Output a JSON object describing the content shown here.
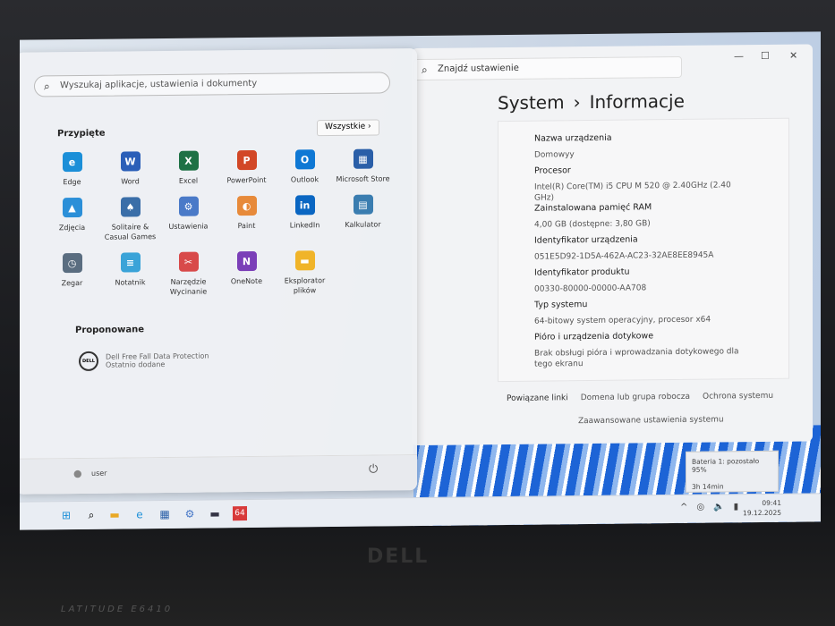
{
  "start": {
    "search_placeholder": "Wyszukaj aplikacje, ustawienia i dokumenty",
    "pinned": "Przypięte",
    "all": "Wszystkie ›",
    "apps": [
      {
        "label": "Edge",
        "icon": "edge-icon",
        "color": "#1b8fd8",
        "g": "e"
      },
      {
        "label": "Word",
        "icon": "word-icon",
        "color": "#2b5fb8",
        "g": "W"
      },
      {
        "label": "Excel",
        "icon": "excel-icon",
        "color": "#1e7145",
        "g": "X"
      },
      {
        "label": "PowerPoint",
        "icon": "powerpoint-icon",
        "color": "#d24726",
        "g": "P"
      },
      {
        "label": "Outlook",
        "icon": "outlook-icon",
        "color": "#0f78d4",
        "g": "O"
      },
      {
        "label": "Microsoft Store",
        "icon": "store-icon",
        "color": "#2a5fa8",
        "g": "▦"
      },
      {
        "label": "Zdjęcia",
        "icon": "photos-icon",
        "color": "#2b8fd8",
        "g": "▲"
      },
      {
        "label": "Solitaire & Casual Games",
        "icon": "solitaire-icon",
        "color": "#3a6ea8",
        "g": "♠"
      },
      {
        "label": "Ustawienia",
        "icon": "settings-icon",
        "color": "#4a7ac8",
        "g": "⚙"
      },
      {
        "label": "Paint",
        "icon": "paint-icon",
        "color": "#e78a3a",
        "g": "◐"
      },
      {
        "label": "LinkedIn",
        "icon": "linkedin-icon",
        "color": "#0a66c2",
        "g": "in"
      },
      {
        "label": "Kalkulator",
        "icon": "calculator-icon",
        "color": "#3a7db0",
        "g": "▤"
      },
      {
        "label": "Zegar",
        "icon": "clock-icon",
        "color": "#5a6d80",
        "g": "◷"
      },
      {
        "label": "Notatnik",
        "icon": "notepad-icon",
        "color": "#3aa3d8",
        "g": "≡"
      },
      {
        "label": "Narzędzie Wycinanie",
        "icon": "snipping-tool-icon",
        "color": "#d84a4a",
        "g": "✂"
      },
      {
        "label": "OneNote",
        "icon": "onenote-icon",
        "color": "#7b3fb8",
        "g": "N"
      },
      {
        "label": "Eksplorator plików",
        "icon": "folder-icon",
        "color": "#f0b429",
        "g": "▬"
      }
    ],
    "recommended": "Proponowane",
    "rec_item": "Dell Free Fall Data Protection",
    "rec_sub": "Ostatnio dodane",
    "rec_logo": "DELL",
    "user": "user"
  },
  "settings": {
    "search_placeholder": "Znajdź ustawienie",
    "crumb1": "System",
    "crumb2": "Informacje",
    "specs": [
      {
        "k": "Nazwa urządzenia",
        "v": "Domowyy"
      },
      {
        "k": "Procesor",
        "v": "Intel(R) Core(TM) i5 CPU       M 520  @ 2.40GHz (2.40 GHz)"
      },
      {
        "k": "Zainstalowana pamięć RAM",
        "v": "4,00 GB (dostępne: 3,80 GB)"
      },
      {
        "k": "Identyfikator urządzenia",
        "v": "051E5D92-1D5A-462A-AC23-32AE8EE8945A"
      },
      {
        "k": "Identyfikator produktu",
        "v": "00330-80000-00000-AA708"
      },
      {
        "k": "Typ systemu",
        "v": "64-bitowy system operacyjny, procesor x64"
      },
      {
        "k": "Pióro i urządzenia dotykowe",
        "v": "Brak obsługi pióra i wprowadzania dotykowego dla tego ekranu"
      }
    ],
    "links_label": "Powiązane linki",
    "link1": "Domena lub grupa robocza",
    "link2": "Ochrona systemu",
    "link3": "Zaawansowane ustawienia systemu"
  },
  "battery": {
    "line1": "Bateria 1: pozostało 95%",
    "line2": "3h 14min"
  },
  "taskbar": {
    "time": "09:41",
    "date": "19.12.2025",
    "app64": "64"
  },
  "hardware": {
    "brand": "DELL",
    "model": "LATITUDE E6410"
  }
}
